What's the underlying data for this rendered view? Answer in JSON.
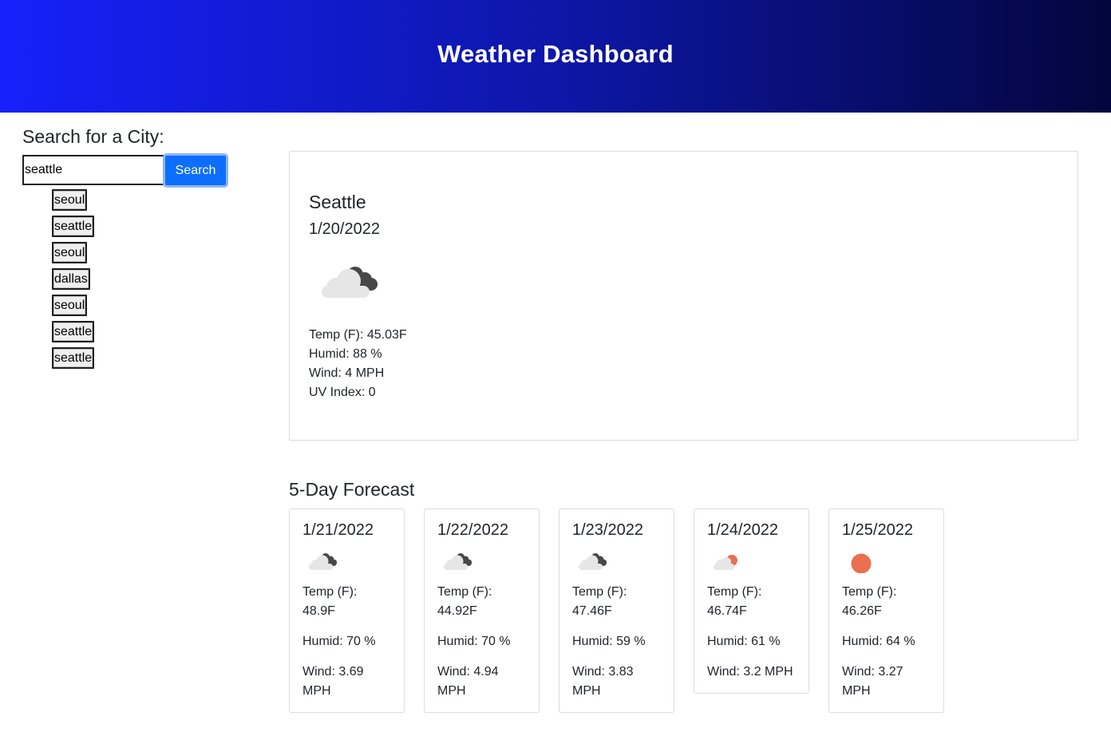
{
  "header": {
    "title": "Weather Dashboard"
  },
  "search": {
    "heading": "Search for a City:",
    "input_value": "seattle",
    "button_label": "Search"
  },
  "history": [
    "seoul",
    "seattle",
    "seoul",
    "dallas",
    "seoul",
    "seattle",
    "seattle"
  ],
  "current": {
    "city": "Seattle",
    "date": "1/20/2022",
    "icon": "broken-clouds-icon",
    "temp": "Temp (F): 45.03F",
    "humid": "Humid: 88 %",
    "wind": "Wind: 4 MPH",
    "uv": "UV Index: 0"
  },
  "forecast": {
    "heading": "5-Day Forecast",
    "days": [
      {
        "date": "1/21/2022",
        "icon": "broken-clouds-icon",
        "temp": "Temp (F): 48.9F",
        "humid": "Humid: 70 %",
        "wind": "Wind: 3.69 MPH"
      },
      {
        "date": "1/22/2022",
        "icon": "broken-clouds-icon",
        "temp": "Temp (F): 44.92F",
        "humid": "Humid: 70 %",
        "wind": "Wind: 4.94 MPH"
      },
      {
        "date": "1/23/2022",
        "icon": "broken-clouds-icon",
        "temp": "Temp (F): 47.46F",
        "humid": "Humid: 59 %",
        "wind": "Wind: 3.83 MPH"
      },
      {
        "date": "1/24/2022",
        "icon": "few-clouds-icon",
        "temp": "Temp (F): 46.74F",
        "humid": "Humid: 61 %",
        "wind": "Wind: 3.2 MPH"
      },
      {
        "date": "1/25/2022",
        "icon": "clear-sky-icon",
        "temp": "Temp (F): 46.26F",
        "humid": "Humid: 64 %",
        "wind": "Wind: 3.27 MPH"
      }
    ]
  },
  "colors": {
    "header_start": "#1720fb",
    "header_end": "#03053d",
    "button": "#0d6efd",
    "sun": "#e96f50",
    "cloud_dark": "#474747",
    "cloud_light": "#e6e6e6"
  }
}
